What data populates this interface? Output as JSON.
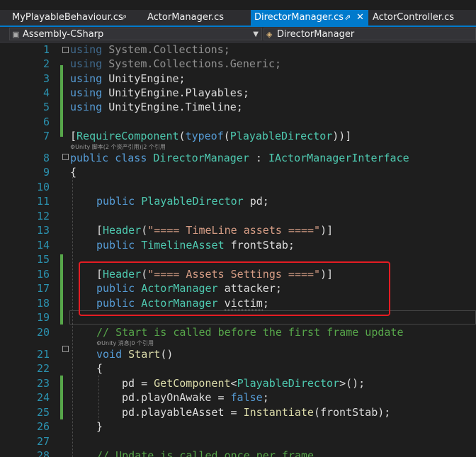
{
  "tabs": [
    {
      "label": "MyPlayableBehaviour.cs",
      "pin": "⇗",
      "active": false
    },
    {
      "label": "ActorManager.cs",
      "active": false
    },
    {
      "label": "DirectorManager.cs",
      "pin": "⇗",
      "close": "✕",
      "active": true
    },
    {
      "label": "ActorController.cs",
      "active": false
    }
  ],
  "nav": {
    "project": "Assembly-CSharp",
    "class": "DirectorManager"
  },
  "codelens": {
    "class_refs": "Unity 脚本(2 个资产引用)|2 个引用",
    "start_refs": "Unity 消息|0 个引用"
  },
  "code": {
    "l1": [
      "using",
      "System.Collections;"
    ],
    "l2": [
      "using",
      "System.Collections.Generic;"
    ],
    "l3": [
      "using",
      "UnityEngine;"
    ],
    "l4": [
      "using",
      "UnityEngine.Playables;"
    ],
    "l5": [
      "using",
      "UnityEngine.Timeline;"
    ],
    "l7": [
      "[",
      "RequireComponent",
      "(",
      "typeof",
      "(",
      "PlayableDirector",
      "))]"
    ],
    "l8": [
      "public",
      "class",
      "DirectorManager",
      ":",
      "IActorManagerInterface"
    ],
    "l9": "{",
    "l11": [
      "public",
      "PlayableDirector",
      "pd;"
    ],
    "l13": [
      "[",
      "Header",
      "(",
      "\"==== TimeLine assets ====\"",
      ")]"
    ],
    "l14": [
      "public",
      "TimelineAsset",
      "frontStab;"
    ],
    "l16": [
      "[",
      "Header",
      "(",
      "\"==== Assets Settings ====\"",
      ")]"
    ],
    "l17": [
      "public",
      "ActorManager",
      "attacker;"
    ],
    "l18": [
      "public",
      "ActorManager",
      "victim",
      ";"
    ],
    "l20": "// Start is called before the first frame update",
    "l21": [
      "void",
      "Start",
      "()"
    ],
    "l22": "{",
    "l23": [
      "pd = ",
      "GetComponent",
      "<",
      "PlayableDirector",
      ">();"
    ],
    "l24": [
      "pd.playOnAwake = ",
      "false",
      ";"
    ],
    "l25": [
      "pd.playableAsset = ",
      "Instantiate",
      "(frontStab);"
    ],
    "l26": "}",
    "l28": "// Update is called once per frame"
  }
}
